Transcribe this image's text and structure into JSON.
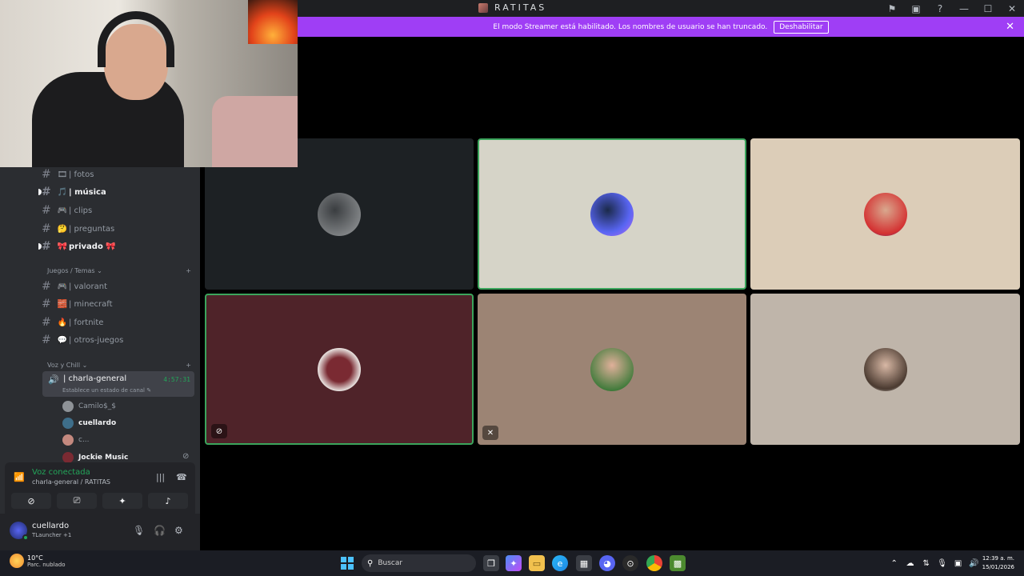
{
  "titlebar": {
    "server_name": "RATITAS",
    "icons": [
      "inbox-icon",
      "screen-icon",
      "help-icon",
      "minimize-icon",
      "maximize-icon",
      "close-icon"
    ]
  },
  "banner": {
    "message": "El modo Streamer está habilitado. Los nombres de usuario se han truncado.",
    "button_label": "Deshabilitar"
  },
  "sidebar": {
    "channels_top": [
      {
        "emoji": "🎞",
        "label": "| fotos"
      },
      {
        "emoji": "🎵",
        "label": "| música"
      },
      {
        "emoji": "🎮",
        "label": "| clips"
      },
      {
        "emoji": "🤔",
        "label": "| preguntas"
      },
      {
        "emoji": "🎀",
        "label": "privado 🎀"
      }
    ],
    "category_games": "Juegos / Temas",
    "channels_games": [
      {
        "emoji": "🎮",
        "label": "| valorant"
      },
      {
        "emoji": "🧱",
        "label": "| minecraft"
      },
      {
        "emoji": "🔥",
        "label": "| fortnite"
      },
      {
        "emoji": "💬",
        "label": "| otros-juegos"
      }
    ],
    "category_voice": "Voz y Chill",
    "voice_channel": {
      "name": "| charla-general",
      "status": "Establece un estado de canal ✎",
      "time": "4:57:31"
    },
    "voice_users": [
      {
        "name": "Camilo$_$"
      },
      {
        "name": "cuellardo"
      },
      {
        "name": "c..."
      },
      {
        "name": "Jockie Music"
      }
    ]
  },
  "voice_panel": {
    "label": "Voz conectada",
    "sub": "charla-general / RATITAS"
  },
  "user_panel": {
    "username": "cuellardo",
    "status": "TLauncher +1"
  },
  "taskbar": {
    "temperature": "10°C",
    "weather": "Parc. nublado",
    "search_placeholder": "Buscar",
    "time": "12:39 a. m.",
    "date": "15/01/2026"
  },
  "colors": {
    "banner": "#9f3ef5",
    "speaking_border": "#3ba55c",
    "sidebar_bg": "#2b2d31"
  }
}
